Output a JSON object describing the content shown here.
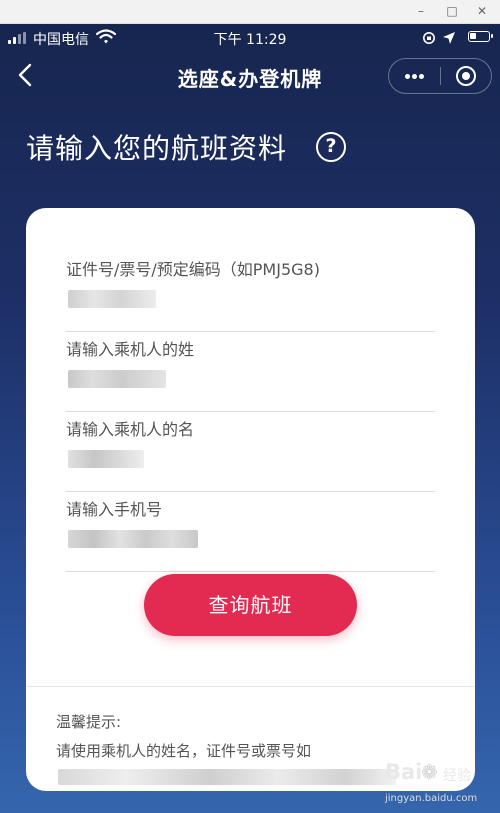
{
  "status_bar": {
    "carrier": "中国电信",
    "time": "下午 11:29"
  },
  "nav": {
    "title": "选座&办登机牌"
  },
  "heading": {
    "title": "请输入您的航班资料",
    "help_glyph": "?"
  },
  "form": {
    "fields": [
      {
        "label": "证件号/票号/预定编码（如PMJ5G8)"
      },
      {
        "label": "请输入乘机人的姓"
      },
      {
        "label": "请输入乘机人的名"
      },
      {
        "label": "请输入手机号"
      }
    ],
    "submit_label": "查询航班"
  },
  "tips": {
    "title": "温馨提示:",
    "text": "请使用乘机人的姓名，证件号或票号如"
  },
  "watermark": {
    "logo": "Bai",
    "suffix": "经验",
    "url": "jingyan.baidu.com"
  },
  "colors": {
    "background_top": "#17264f",
    "background_bottom": "#3566ad",
    "primary_button": "#e32a50",
    "card": "#ffffff"
  }
}
